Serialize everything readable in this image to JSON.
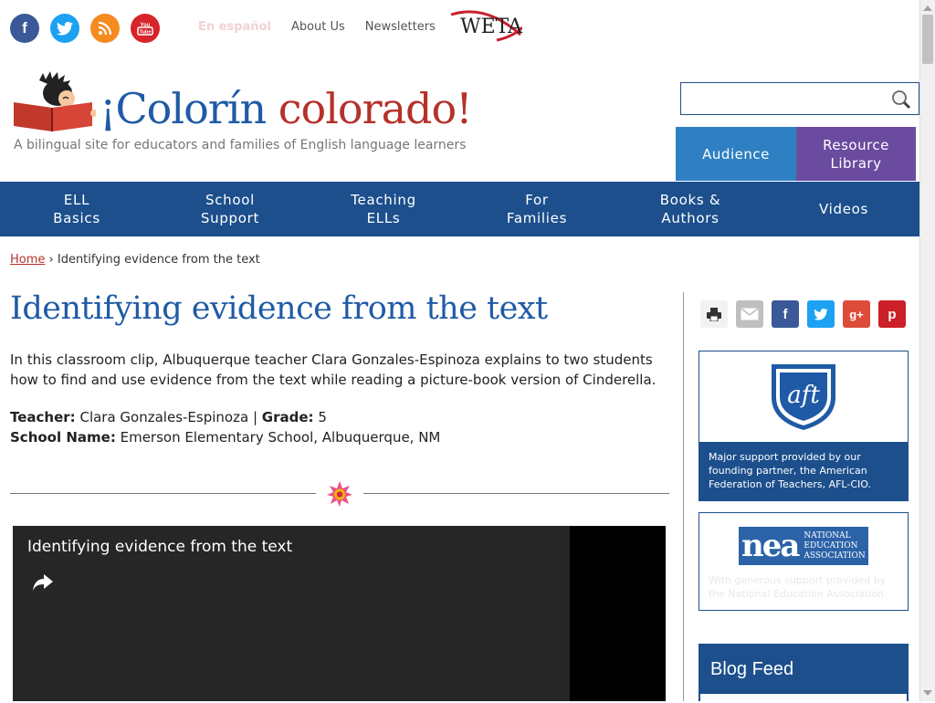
{
  "social": {
    "facebook": "f",
    "twitter": "t",
    "rss": "rss",
    "youtube": "You Tube"
  },
  "toplinks": {
    "spanish": "En español",
    "about": "About Us",
    "newsletters": "Newsletters",
    "weta": "WETA"
  },
  "brand": {
    "title_part1": "¡Colorín",
    "title_part2": " colorado!",
    "tagline": "A bilingual site for educators and families of English language learners"
  },
  "search": {
    "placeholder": ""
  },
  "tabs": {
    "audience": "Audience",
    "resource": "Resource Library"
  },
  "nav": [
    {
      "label": "ELL Basics"
    },
    {
      "label": "School Support"
    },
    {
      "label": "Teaching ELLs"
    },
    {
      "label": "For Families"
    },
    {
      "label": "Books & Authors"
    },
    {
      "label": "Videos"
    }
  ],
  "breadcrumb": {
    "home": "Home",
    "sep": " › ",
    "current": "Identifying evidence from the text"
  },
  "article": {
    "title": "Identifying evidence from the text",
    "intro": "In this classroom clip, Albuquerque teacher Clara Gonzales-Espinoza explains to two students how to find and use evidence from the text while reading a picture-book version of Cinderella.",
    "teacher_label": "Teacher:",
    "teacher": "Clara Gonzales-Espinoza",
    "sep": "|",
    "grade_label": "Grade:",
    "grade": "5",
    "school_label": "School Name:",
    "school": "Emerson Elementary School, Albuquerque, NM"
  },
  "video": {
    "title": "Identifying evidence from the text"
  },
  "share": {
    "print": "print-icon",
    "email": "email-icon",
    "facebook": "f",
    "twitter": "t",
    "googleplus": "g+",
    "pinterest": "p"
  },
  "sidebar": {
    "aft_logo": "aft",
    "aft_caption": "Major support provided by our founding partner, the American Federation of Teachers, AFL-CIO.",
    "nea_logo": "nea",
    "nea_name": "NATIONAL EDUCATION ASSOCIATION",
    "nea_caption": "With generous support provided by the National Education Association.",
    "blog_title": "Blog Feed"
  },
  "colors": {
    "nav_blue": "#1c4f8c",
    "audience_blue": "#2f80c2",
    "resource_purple": "#6b4b9f",
    "brand_red": "#b5312a",
    "brand_blue": "#1f5aa6"
  }
}
